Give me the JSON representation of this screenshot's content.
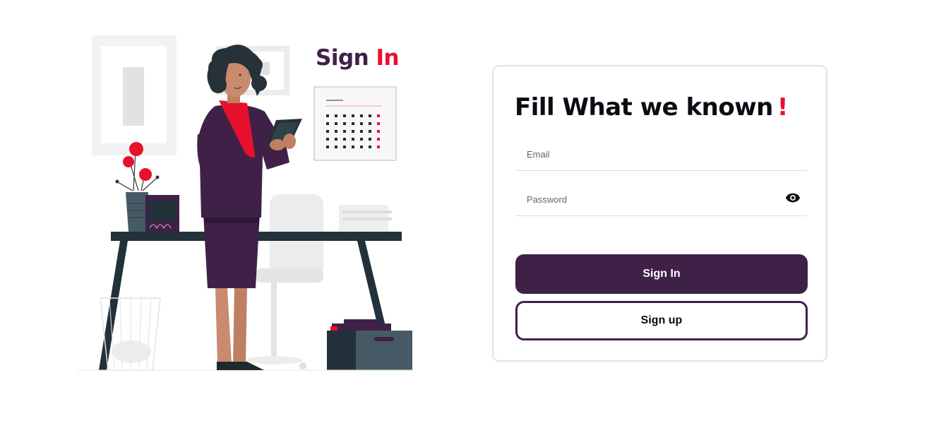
{
  "hero": {
    "title_part1": "Sign",
    "title_part2": "In"
  },
  "form": {
    "title": "Fill What we known",
    "title_mark": "!",
    "email_placeholder": "Email",
    "password_placeholder": "Password",
    "eye_icon": "eye-icon",
    "sign_in_label": "Sign In",
    "sign_up_label": "Sign up"
  },
  "colors": {
    "brand_purple": "#3f2148",
    "accent_red": "#e8112d",
    "card_border": "#e3e3e3"
  }
}
